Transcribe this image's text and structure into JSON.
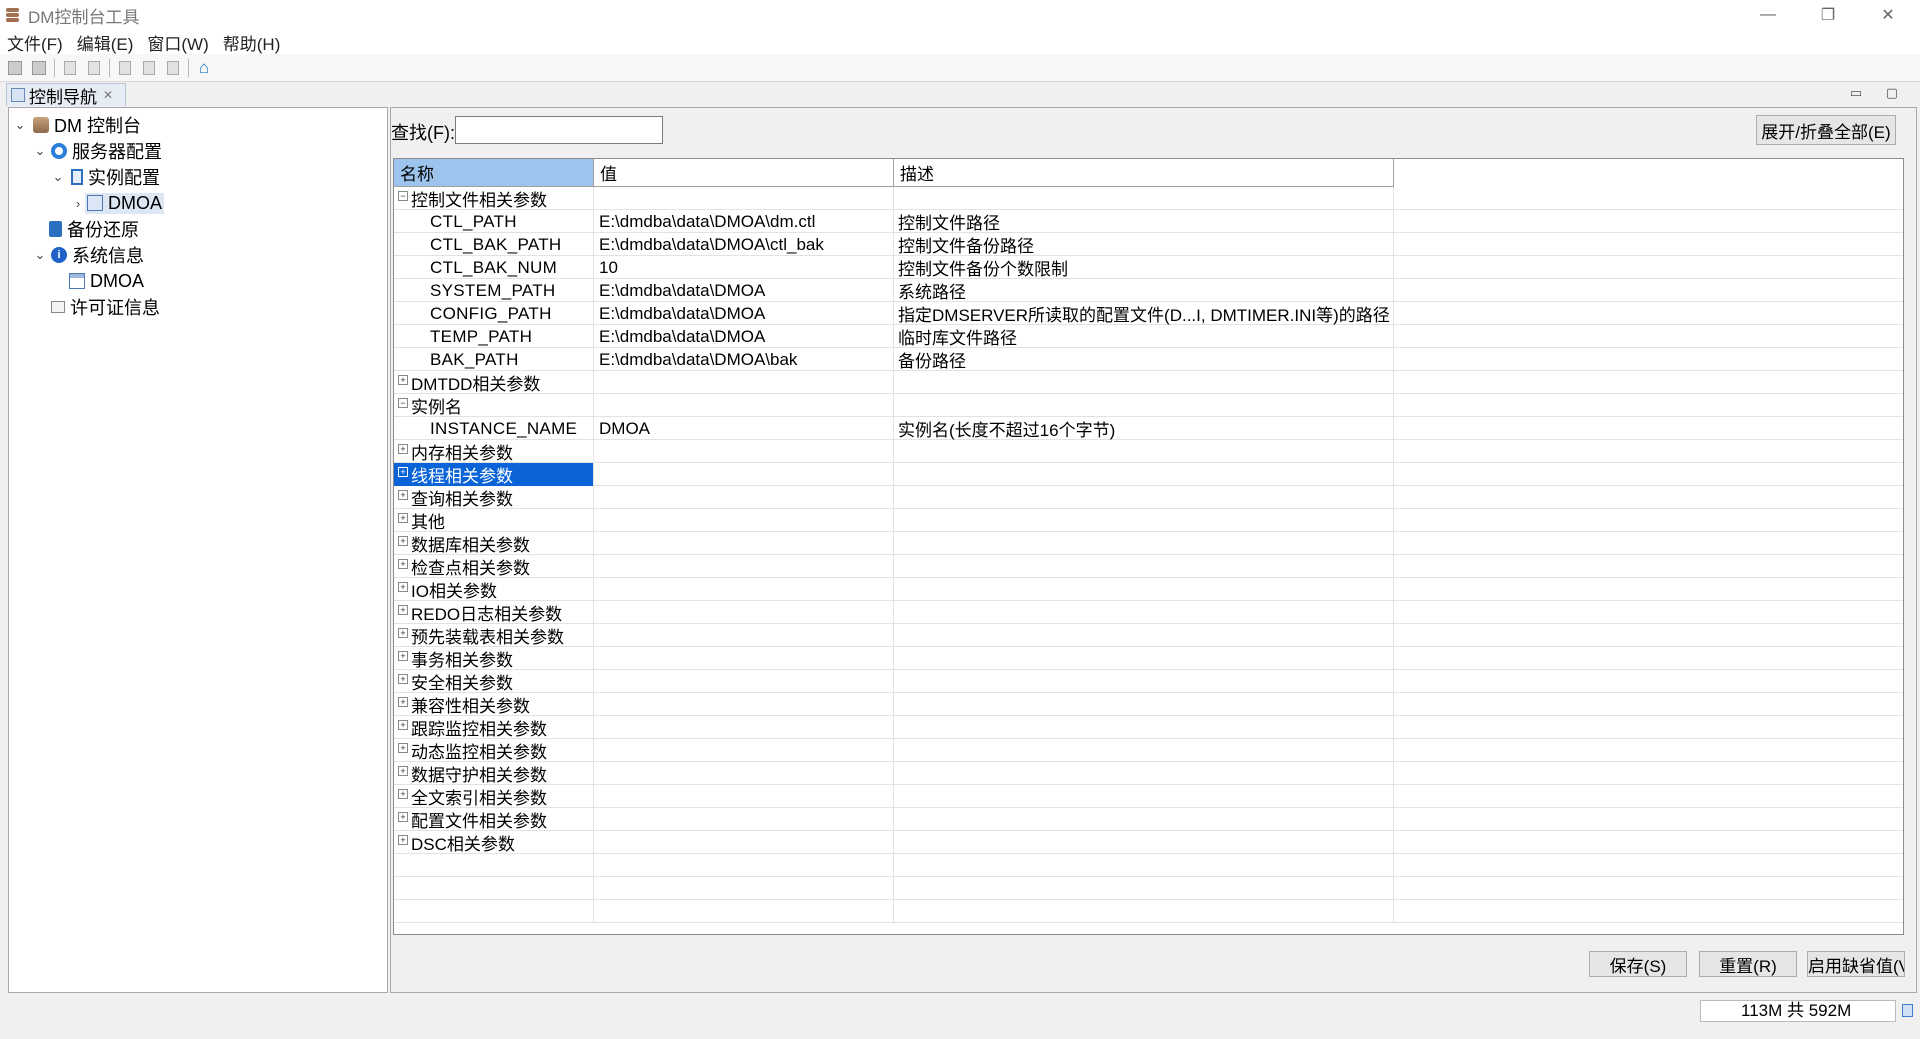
{
  "window": {
    "title": "DM控制台工具",
    "minimize": "—",
    "maximize": "❐",
    "close": "✕"
  },
  "menu": [
    "文件(F)",
    "编辑(E)",
    "窗口(W)",
    "帮助(H)"
  ],
  "nav": {
    "tab_label": "控制导航",
    "tab_close": "✕",
    "tree": {
      "root": "DM 控制台",
      "server_config": "服务器配置",
      "instance_config": "实例配置",
      "instance_node": "DMOA",
      "backup": "备份还原",
      "sysinfo": "系统信息",
      "sysinfo_node": "DMOA",
      "license": "许可证信息"
    }
  },
  "editor": {
    "view_controls": "▭ ▢",
    "search_label": "查找(F):",
    "search_value": "",
    "expand_all": "展开/折叠全部(E)",
    "columns": {
      "name": "名称",
      "value": "值",
      "desc": "描述"
    },
    "rows": [
      {
        "name": "控制文件相关参数",
        "toggle": "−"
      },
      {
        "name": "CTL_PATH",
        "value": "E:\\dmdba\\data\\DMOA\\dm.ctl",
        "desc": "控制文件路径"
      },
      {
        "name": "CTL_BAK_PATH",
        "value": "E:\\dmdba\\data\\DMOA\\ctl_bak",
        "desc": "控制文件备份路径"
      },
      {
        "name": "CTL_BAK_NUM",
        "value": "10",
        "desc": "控制文件备份个数限制"
      },
      {
        "name": "SYSTEM_PATH",
        "value": "E:\\dmdba\\data\\DMOA",
        "desc": "系统路径"
      },
      {
        "name": "CONFIG_PATH",
        "value": "E:\\dmdba\\data\\DMOA",
        "desc": "指定DMSERVER所读取的配置文件(D...I, DMTIMER.INI等)的路径"
      },
      {
        "name": "TEMP_PATH",
        "value": "E:\\dmdba\\data\\DMOA",
        "desc": "临时库文件路径"
      },
      {
        "name": "BAK_PATH",
        "value": "E:\\dmdba\\data\\DMOA\\bak",
        "desc": "备份路径"
      },
      {
        "name": "DMTDD相关参数",
        "toggle": "+"
      },
      {
        "name": "实例名",
        "toggle": "−"
      },
      {
        "name": "INSTANCE_NAME",
        "value": "DMOA",
        "desc": "实例名(长度不超过16个字节)"
      },
      {
        "name": "内存相关参数",
        "toggle": "+"
      },
      {
        "name": "线程相关参数",
        "toggle": "+"
      },
      {
        "name": "查询相关参数",
        "toggle": "+"
      },
      {
        "name": "其他",
        "toggle": "+"
      },
      {
        "name": "数据库相关参数",
        "toggle": "+"
      },
      {
        "name": "检查点相关参数",
        "toggle": "+"
      },
      {
        "name": "IO相关参数",
        "toggle": "+"
      },
      {
        "name": "REDO日志相关参数",
        "toggle": "+"
      },
      {
        "name": "预先装载表相关参数",
        "toggle": "+"
      },
      {
        "name": "事务相关参数",
        "toggle": "+"
      },
      {
        "name": "安全相关参数",
        "toggle": "+"
      },
      {
        "name": "兼容性相关参数",
        "toggle": "+"
      },
      {
        "name": "跟踪监控相关参数",
        "toggle": "+"
      },
      {
        "name": "动态监控相关参数",
        "toggle": "+"
      },
      {
        "name": "数据守护相关参数",
        "toggle": "+"
      },
      {
        "name": "全文索引相关参数",
        "toggle": "+"
      },
      {
        "name": "配置文件相关参数",
        "toggle": "+"
      },
      {
        "name": "DSC相关参数",
        "toggle": "+"
      }
    ],
    "save": "保存(S)",
    "reset": "重置(R)",
    "defaults": "启用缺省值(V)"
  },
  "status": {
    "memory": "113M 共 592M"
  }
}
